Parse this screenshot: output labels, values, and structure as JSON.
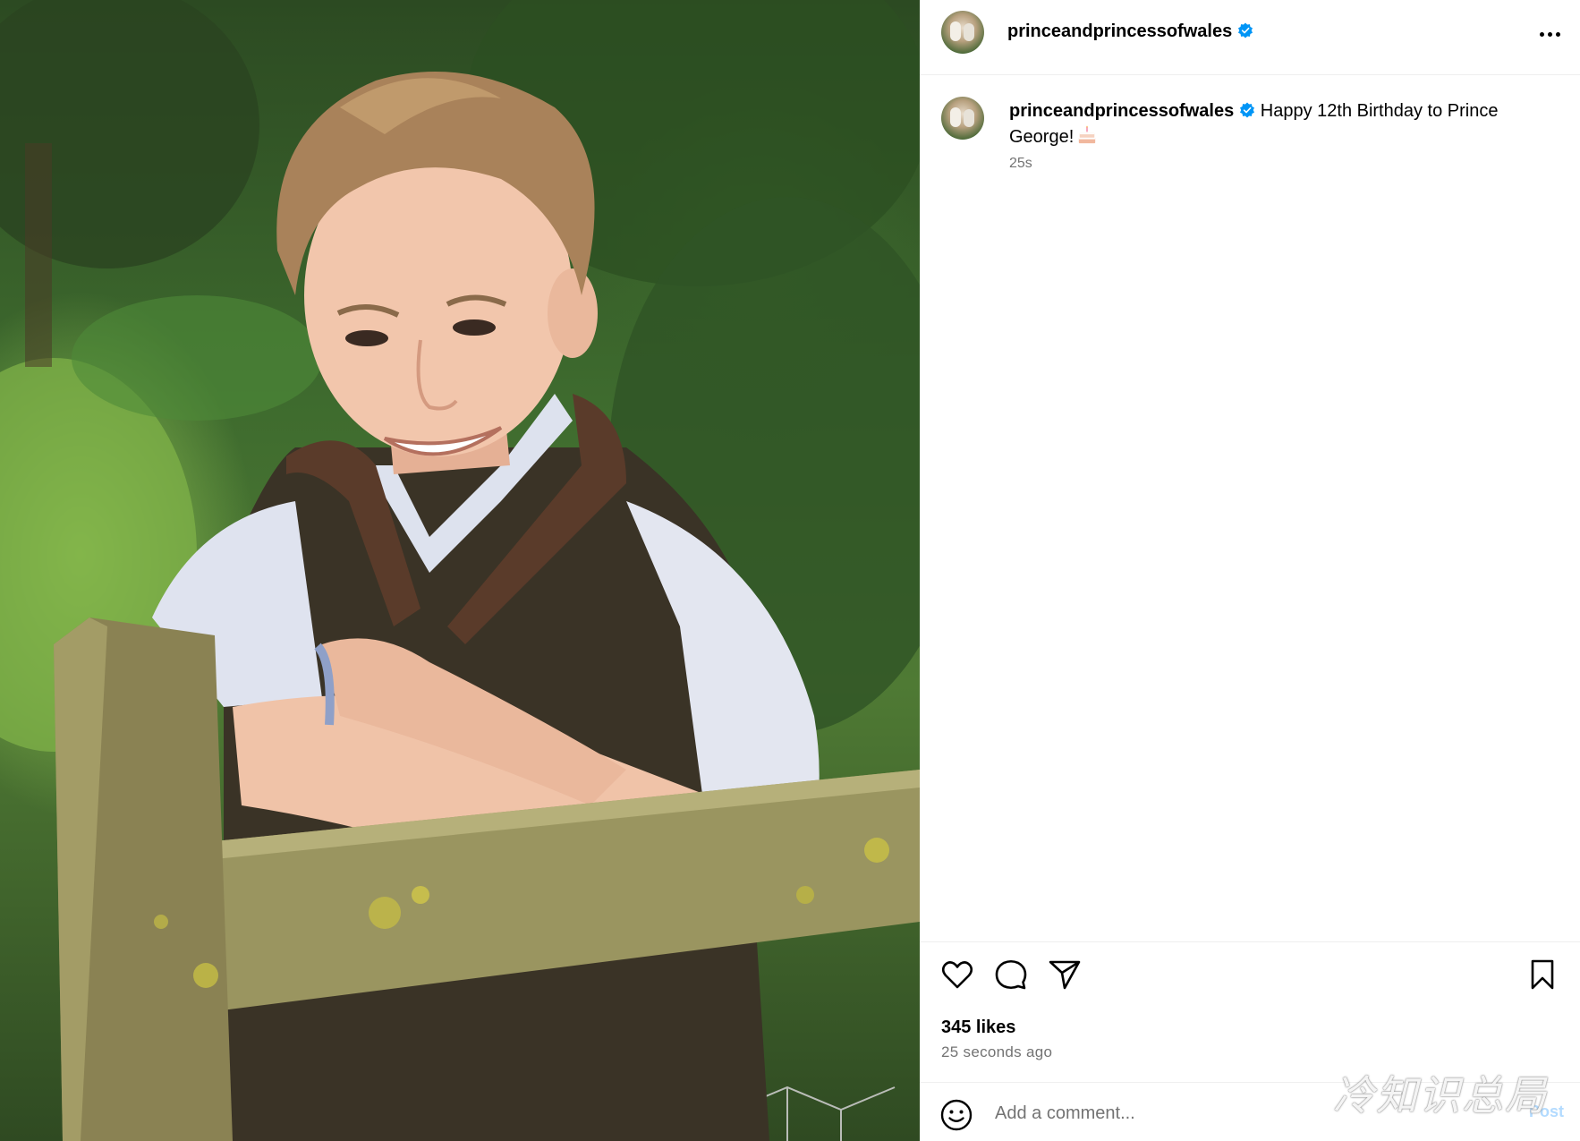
{
  "post": {
    "username": "princeandprincessofwales",
    "verified": true,
    "photo_subject": "boy-in-gilet-leaning-on-fence-photo",
    "caption": {
      "text": "Happy 12th Birthday to Prince George!",
      "emoji": "birthday-cake-icon",
      "time_short": "25s"
    },
    "likes_label": "345 likes",
    "time_long": "25 seconds ago"
  },
  "actions": {
    "like_icon": "heart-icon",
    "comment_icon": "comment-icon",
    "share_icon": "paper-plane-icon",
    "save_icon": "bookmark-icon",
    "more_icon": "more-options-icon"
  },
  "comment_bar": {
    "emoji_icon": "smiley-icon",
    "placeholder": "Add a comment...",
    "post_label": "Post"
  },
  "watermark": "冷知识总局",
  "colors": {
    "verified_blue": "#0095f6",
    "secondary_text": "#737373",
    "post_button_disabled": "#b3dbff",
    "divider": "#efefef"
  }
}
